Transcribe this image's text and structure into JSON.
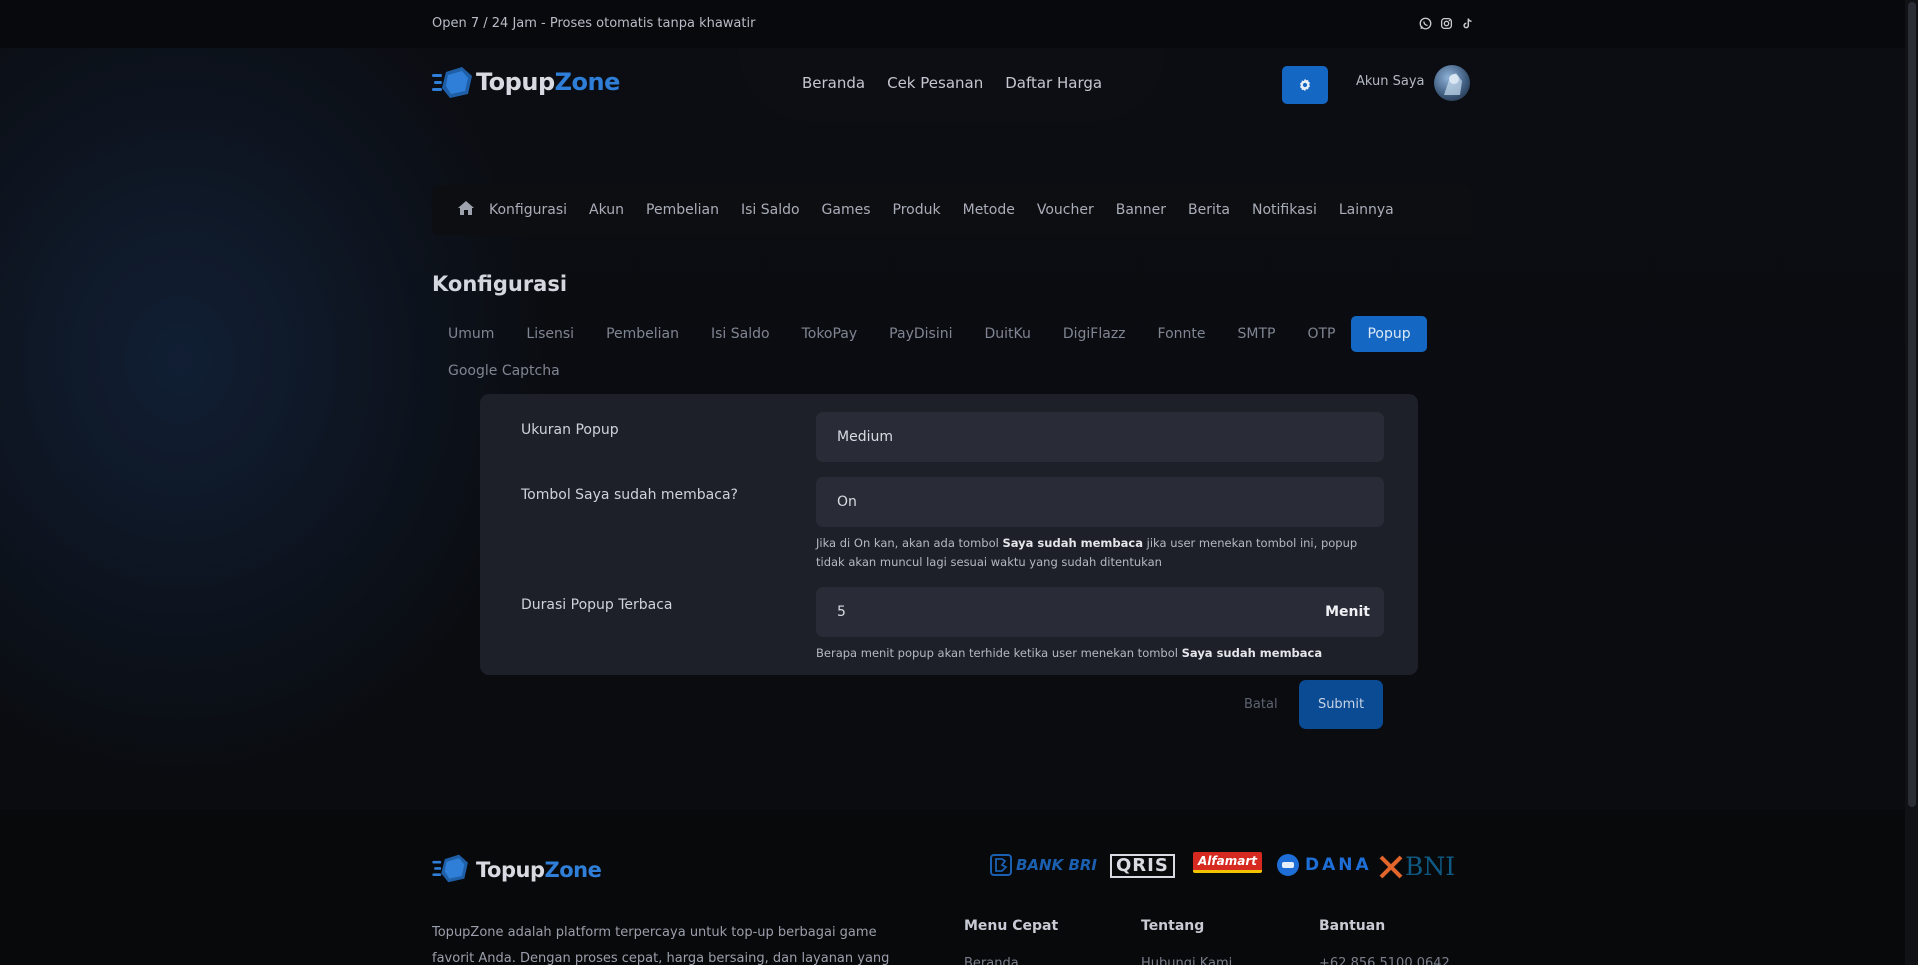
{
  "topbar": {
    "text": "Open 7 / 24 Jam - Proses otomatis tanpa khawatir",
    "social": [
      "whatsapp-icon",
      "instagram-icon",
      "tiktok-icon"
    ]
  },
  "brand": {
    "name_a": "Topup",
    "name_b": "Zone",
    "accent": "#2f7fd8"
  },
  "header": {
    "nav": [
      "Beranda",
      "Cek Pesanan",
      "Daftar Harga"
    ],
    "settings_icon": "gear-icon",
    "account_label": "Akun Saya"
  },
  "admin_nav": {
    "home_icon": "home-icon",
    "items": [
      "Konfigurasi",
      "Akun",
      "Pembelian",
      "Isi Saldo",
      "Games",
      "Produk",
      "Metode",
      "Voucher",
      "Banner",
      "Berita",
      "Notifikasi",
      "Lainnya"
    ]
  },
  "page": {
    "title": "Konfigurasi"
  },
  "config_tabs": {
    "items": [
      "Umum",
      "Lisensi",
      "Pembelian",
      "Isi Saldo",
      "TokoPay",
      "PayDisini",
      "DuitKu",
      "DigiFlazz",
      "Fonnte",
      "SMTP",
      "OTP",
      "Popup",
      "Google Captcha"
    ],
    "active": "Popup"
  },
  "form": {
    "popup_size": {
      "label": "Ukuran Popup",
      "value": "Medium"
    },
    "read_button": {
      "label": "Tombol Saya sudah membaca?",
      "value": "On",
      "help_pre": "Jika di On kan, akan ada tombol ",
      "help_bold": "Saya sudah membaca",
      "help_post": " jika user menekan tombol ini, popup tidak akan muncul lagi sesuai waktu yang sudah ditentukan"
    },
    "read_duration": {
      "label": "Durasi Popup Terbaca",
      "value": "5",
      "suffix": "Menit",
      "help_pre": "Berapa menit popup akan terhide ketika user menekan tombol ",
      "help_bold": "Saya sudah membaca"
    },
    "cancel_label": "Batal",
    "submit_label": "Submit"
  },
  "footer": {
    "description": "TopupZone adalah platform terpercaya untuk top-up berbagai game favorit Anda. Dengan proses cepat, harga bersaing, dan layanan yang mudah",
    "payments": [
      "BANK BRI",
      "QRIS",
      "Alfamart",
      "DANA",
      "BNI"
    ],
    "columns": [
      {
        "title": "Menu Cepat",
        "first_link": "Beranda"
      },
      {
        "title": "Tentang",
        "first_link": "Hubungi Kami"
      },
      {
        "title": "Bantuan",
        "first_link": "+62 856 5100 0642"
      }
    ]
  }
}
